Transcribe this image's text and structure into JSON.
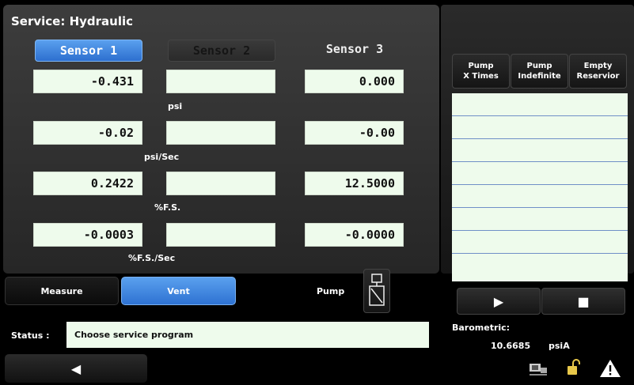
{
  "header": {
    "title": "Service: Hydraulic"
  },
  "sensors": {
    "sensor1": "Sensor 1",
    "sensor2": "Sensor 2",
    "sensor3": "Sensor 3"
  },
  "rows": [
    {
      "s1": "-0.431",
      "s2": "",
      "s3": "0.000",
      "unit": "psi"
    },
    {
      "s1": "-0.02",
      "s2": "",
      "s3": "-0.00",
      "unit": "psi/Sec"
    },
    {
      "s1": "0.2422",
      "s2": "",
      "s3": "12.5000",
      "unit": "%F.S."
    },
    {
      "s1": "-0.0003",
      "s2": "",
      "s3": "-0.0000",
      "unit": "%F.S./Sec"
    }
  ],
  "modes": {
    "measure": "Measure",
    "vent": "Vent",
    "pump": "Pump"
  },
  "pump_options": {
    "x_times": {
      "line1": "Pump",
      "line2": "X Times"
    },
    "indefinite": {
      "line1": "Pump",
      "line2": "Indefinite"
    },
    "empty": {
      "line1": "Empty",
      "line2": "Reservior"
    }
  },
  "controls": {
    "play_icon": "play-icon",
    "stop_icon": "stop-icon"
  },
  "status": {
    "label": "Status :",
    "message": "Choose service program"
  },
  "barometric": {
    "label": "Barometric:",
    "value": "10.6685",
    "unit": "psiA"
  },
  "colors": {
    "accent_blue": "#3b82e0",
    "display_green": "#eefbec",
    "warning_white": "#ffffff"
  }
}
